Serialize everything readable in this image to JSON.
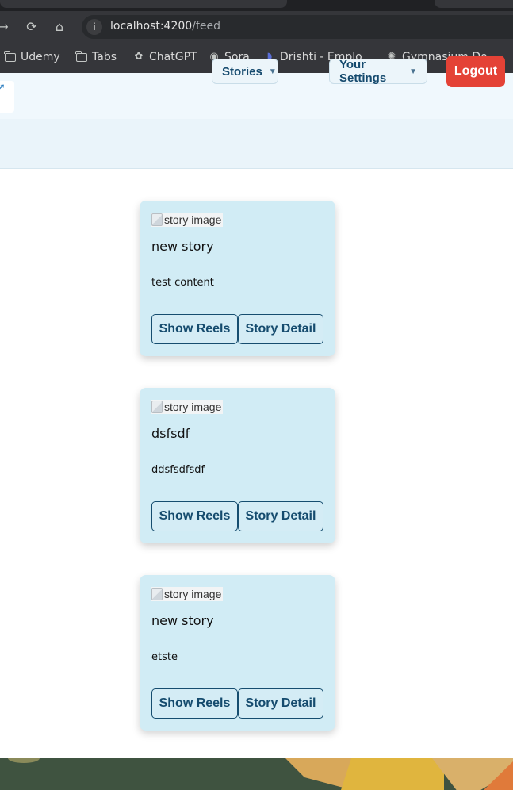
{
  "browser": {
    "url_host": "localhost:4200",
    "url_path": "/feed",
    "bookmarks": [
      {
        "label": "Udemy",
        "icon": "folder-icon"
      },
      {
        "label": "Tabs",
        "icon": "folder-icon"
      },
      {
        "label": "ChatGPT",
        "icon": "chatgpt-icon"
      },
      {
        "label": "Sora",
        "icon": "sora-icon"
      },
      {
        "label": "Drishti - Emplo…",
        "icon": "drishti-icon"
      },
      {
        "label": "Gymnasium Do…",
        "icon": "gymnasium-icon"
      }
    ]
  },
  "header": {
    "nav": {
      "stories_label": "Stories",
      "settings_label": "Your Settings",
      "logout_label": "Logout"
    },
    "colors": {
      "logout": "#e44236",
      "nav_text": "#154a6e"
    }
  },
  "feed": {
    "stories": [
      {
        "image_alt": "story image",
        "title": "new story",
        "content": "test content",
        "reels_label": "Show Reels",
        "detail_label": "Story Detail"
      },
      {
        "image_alt": "story image",
        "title": "dsfsdf",
        "content": "ddsfsdfsdf",
        "reels_label": "Show Reels",
        "detail_label": "Story Detail"
      },
      {
        "image_alt": "story image",
        "title": "new story",
        "content": "etste",
        "reels_label": "Show Reels",
        "detail_label": "Story Detail"
      }
    ],
    "colors": {
      "card_bg": "#d1ecf5",
      "button_border": "#164d6f"
    }
  }
}
